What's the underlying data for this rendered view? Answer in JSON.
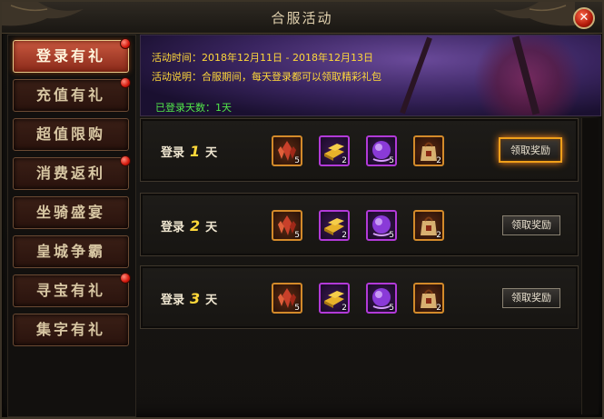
{
  "window": {
    "title": "合服活动",
    "close_glyph": "✕"
  },
  "sidebar": {
    "items": [
      {
        "label": "登录有礼",
        "active": true,
        "notify": true
      },
      {
        "label": "充值有礼",
        "active": false,
        "notify": true
      },
      {
        "label": "超值限购",
        "active": false,
        "notify": false
      },
      {
        "label": "消费返利",
        "active": false,
        "notify": true
      },
      {
        "label": "坐骑盛宴",
        "active": false,
        "notify": false
      },
      {
        "label": "皇城争霸",
        "active": false,
        "notify": false
      },
      {
        "label": "寻宝有礼",
        "active": false,
        "notify": true
      },
      {
        "label": "集字有礼",
        "active": false,
        "notify": false
      }
    ]
  },
  "banner": {
    "time_label": "活动时间：",
    "time_value": "2018年12月11日 - 2018年12月13日",
    "desc_label": "活动说明：",
    "desc_value": "合服期间，每天登录都可以领取精彩礼包",
    "login_days_label": "已登录天数：",
    "login_days_value": "1天"
  },
  "rows": [
    {
      "prefix": "登录",
      "day": "1",
      "suffix": "天",
      "button": "领取奖励",
      "claimable": true,
      "items": [
        {
          "icon": "red-crystal-icon",
          "qty": "5"
        },
        {
          "icon": "gold-bar-icon",
          "qty": "2"
        },
        {
          "icon": "purple-orb-icon",
          "qty": "5"
        },
        {
          "icon": "gift-bag-icon",
          "qty": "2"
        }
      ]
    },
    {
      "prefix": "登录",
      "day": "2",
      "suffix": "天",
      "button": "领取奖励",
      "claimable": false,
      "items": [
        {
          "icon": "red-crystal-icon",
          "qty": "5"
        },
        {
          "icon": "gold-bar-icon",
          "qty": "2"
        },
        {
          "icon": "purple-orb-icon",
          "qty": "5"
        },
        {
          "icon": "gift-bag-icon",
          "qty": "2"
        }
      ]
    },
    {
      "prefix": "登录",
      "day": "3",
      "suffix": "天",
      "button": "领取奖励",
      "claimable": false,
      "items": [
        {
          "icon": "red-crystal-icon",
          "qty": "5"
        },
        {
          "icon": "gold-bar-icon",
          "qty": "2"
        },
        {
          "icon": "purple-orb-icon",
          "qty": "5"
        },
        {
          "icon": "gift-bag-icon",
          "qty": "2"
        }
      ]
    }
  ]
}
